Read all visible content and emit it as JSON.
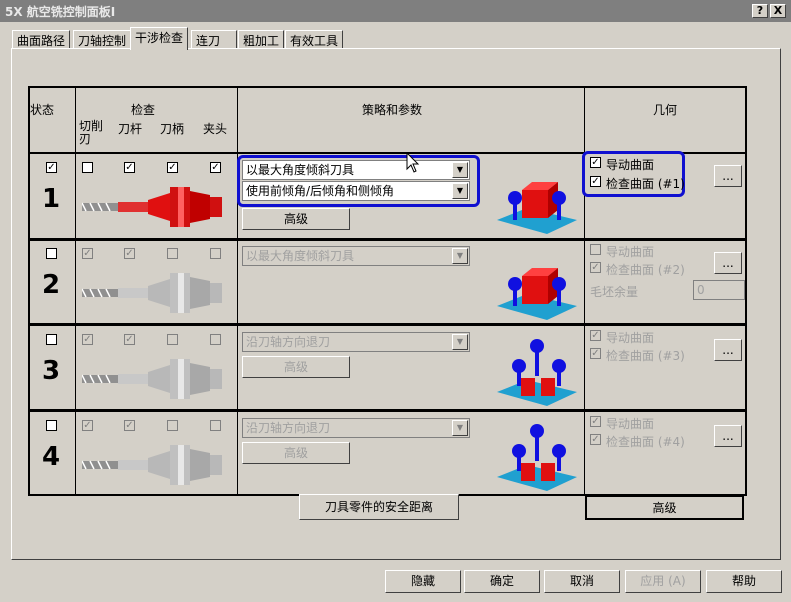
{
  "window": {
    "title": "5X 航空铣控制面板I",
    "help_btn": "?",
    "close_btn": "X"
  },
  "tabs": [
    {
      "label": "曲面路径",
      "active": false
    },
    {
      "label": "刀轴控制",
      "active": false
    },
    {
      "label": "干涉检查",
      "active": true
    },
    {
      "label": "连刀",
      "active": false
    },
    {
      "label": "粗加工",
      "active": false
    },
    {
      "label": "有效工具",
      "active": false
    }
  ],
  "headers": {
    "status": "状态",
    "check": "检查",
    "cut_edge": "切削刃",
    "holder_shank": "刀杆",
    "holder": "刀柄",
    "chuck": "夹头",
    "strategy": "策略和参数",
    "geometry": "几何"
  },
  "rows": [
    {
      "num": "1",
      "enabled": true,
      "status": true,
      "checks": [
        false,
        true,
        true,
        true
      ],
      "strategy": "以最大角度倾斜刀具",
      "strategy2": "使用前倾角/后倾角和侧倾角",
      "adv": "高级",
      "geo": [
        {
          "label": "导动曲面",
          "checked": true
        },
        {
          "label": "检查曲面 (#1)",
          "checked": true
        }
      ],
      "more": "..."
    },
    {
      "num": "2",
      "enabled": false,
      "status": false,
      "checks": [
        true,
        true,
        false,
        false
      ],
      "strategy": "以最大角度倾斜刀具",
      "geo": [
        {
          "label": "导动曲面",
          "checked": false
        },
        {
          "label": "检查曲面 (#2)",
          "checked": true
        }
      ],
      "more": "...",
      "stock_label": "毛坯余量",
      "stock_value": "0"
    },
    {
      "num": "3",
      "enabled": false,
      "status": false,
      "checks": [
        true,
        true,
        false,
        false
      ],
      "strategy": "沿刀轴方向退刀",
      "adv": "高级",
      "geo": [
        {
          "label": "导动曲面",
          "checked": true
        },
        {
          "label": "检查曲面 (#3)",
          "checked": true
        }
      ],
      "more": "..."
    },
    {
      "num": "4",
      "enabled": false,
      "status": false,
      "checks": [
        true,
        true,
        false,
        false
      ],
      "strategy": "沿刀轴方向退刀",
      "adv": "高级",
      "geo": [
        {
          "label": "导动曲面",
          "checked": true
        },
        {
          "label": "检查曲面 (#4)",
          "checked": true
        }
      ],
      "more": "..."
    }
  ],
  "safety_btn": "刀具零件的安全距离",
  "geo_adv_btn": "高级",
  "footer": {
    "hide": "隐藏",
    "ok": "确定",
    "cancel": "取消",
    "apply": "应用 (A)",
    "help": "帮助"
  },
  "colors": {
    "highlight": "#1010d0",
    "tool_red": "#e01010",
    "tool_gray": "#c8c8c8",
    "title_bar": "#7f7f7f"
  }
}
